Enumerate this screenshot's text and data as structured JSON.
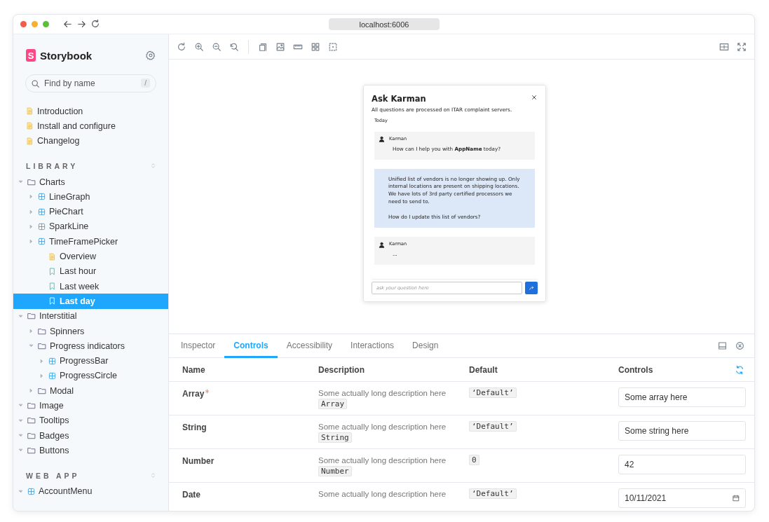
{
  "browser": {
    "url": "localhost:6006"
  },
  "sidebar": {
    "logo_letter": "S",
    "brand": "Storybook",
    "search": {
      "placeholder": "Find by name",
      "shortcut": "/"
    },
    "docs": [
      {
        "kind": "doc",
        "label": "Introduction",
        "selected": false
      },
      {
        "kind": "doc",
        "label": "Install and configure",
        "selected": false
      },
      {
        "kind": "doc",
        "label": "Changelog",
        "selected": false
      }
    ],
    "sections": [
      {
        "title": "LIBRARY",
        "items": [
          {
            "kind": "folder",
            "label": "Charts",
            "expanded": true,
            "selected": false,
            "children": [
              {
                "kind": "component",
                "label": "LineGraph",
                "expanded": false,
                "selected": false
              },
              {
                "kind": "component",
                "label": "PieChart",
                "expanded": false,
                "selected": false
              },
              {
                "kind": "component",
                "label": "SparkLine",
                "expanded": false,
                "selected": false
              },
              {
                "kind": "component",
                "label": "TimeFramePicker",
                "expanded": false,
                "selected": false,
                "children": [
                  {
                    "kind": "doc",
                    "label": "Overview",
                    "selected": false
                  },
                  {
                    "kind": "story",
                    "label": "Last hour",
                    "selected": false
                  },
                  {
                    "kind": "story",
                    "label": "Last week",
                    "selected": false
                  },
                  {
                    "kind": "story",
                    "label": "Last day",
                    "selected": true
                  }
                ]
              }
            ]
          },
          {
            "kind": "folder",
            "label": "Interstitial",
            "expanded": true,
            "selected": false,
            "children": [
              {
                "kind": "folder",
                "label": "Spinners",
                "expanded": false,
                "selected": false
              },
              {
                "kind": "folder",
                "label": "Progress indicators",
                "expanded": true,
                "selected": false,
                "children": [
                  {
                    "kind": "component",
                    "label": "ProgressBar",
                    "expanded": false,
                    "selected": false
                  },
                  {
                    "kind": "component",
                    "label": "ProgressCircle",
                    "expanded": false,
                    "selected": false
                  }
                ]
              },
              {
                "kind": "folder",
                "label": "Modal",
                "expanded": false,
                "selected": false
              }
            ]
          },
          {
            "kind": "folder",
            "label": "Image",
            "expanded": true,
            "selected": false
          },
          {
            "kind": "folder",
            "label": "Tooltips",
            "expanded": true,
            "selected": false
          },
          {
            "kind": "folder",
            "label": "Badges",
            "expanded": true,
            "selected": false
          },
          {
            "kind": "folder",
            "label": "Buttons",
            "expanded": true,
            "selected": false
          }
        ]
      },
      {
        "title": "WEB APP",
        "items": [
          {
            "kind": "component",
            "label": "AccountMenu",
            "expanded": true,
            "selected": false
          }
        ]
      }
    ]
  },
  "preview": {
    "chat": {
      "title": "Ask Karman",
      "subtitle": "All questions are processed on ITAR complaint servers.",
      "day": "Today",
      "messages": [
        {
          "kind": "bot",
          "author": "Karman",
          "text": "How can I help you with **AppName** today?"
        },
        {
          "kind": "user",
          "text": "Unified list of vendors is no longer showing up. Only internal locations are present on shipping locations. We have lots of 3rd party certified processors we need to send to.\n\nHow do I update this list of vendors?"
        },
        {
          "kind": "bot",
          "author": "Karman",
          "text": "..."
        }
      ],
      "input": {
        "placeholder": "ask your question here"
      }
    }
  },
  "panel": {
    "tabs": [
      {
        "label": "Inspector",
        "selected": false
      },
      {
        "label": "Controls",
        "selected": true
      },
      {
        "label": "Accessibility",
        "selected": false
      },
      {
        "label": "Interactions",
        "selected": false
      },
      {
        "label": "Design",
        "selected": false
      }
    ],
    "table": {
      "columns": [
        "Name",
        "Description",
        "Default",
        "Controls"
      ],
      "rows": [
        {
          "name": "Array",
          "required": true,
          "description": "Some actually long description here",
          "type": "Array",
          "default": "‘Default’",
          "kind": "text",
          "value": "Some array here"
        },
        {
          "name": "String",
          "required": false,
          "description": "Some actually long description here",
          "type": "String",
          "default": "‘Default’",
          "kind": "text",
          "value": "Some string here"
        },
        {
          "name": "Number",
          "required": false,
          "description": "Some actually long description here",
          "type": "Number",
          "default": "0",
          "kind": "text",
          "value": "42"
        },
        {
          "name": "Date",
          "required": false,
          "description": "Some actually long description here",
          "default": "‘Default’",
          "kind": "date",
          "value": "10/11/2021"
        }
      ]
    }
  }
}
